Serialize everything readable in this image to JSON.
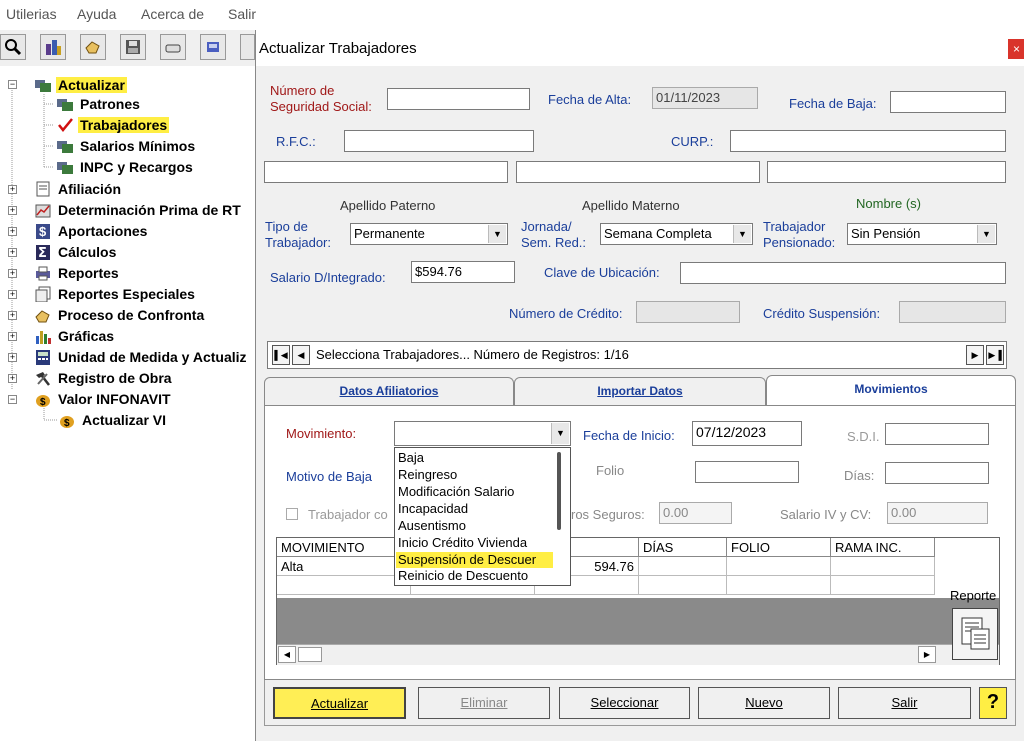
{
  "menubar": {
    "items": [
      "Utilerias",
      "Ayuda",
      "Acerca de",
      "Salir"
    ]
  },
  "tree": {
    "items": [
      {
        "label": "Actualizar",
        "expander": "−",
        "highlight": true
      },
      {
        "label": "Patrones"
      },
      {
        "label": "Trabajadores",
        "highlight": true
      },
      {
        "label": "Salarios Mínimos"
      },
      {
        "label": "INPC y Recargos"
      },
      {
        "label": "Afiliación",
        "expander": "+"
      },
      {
        "label": "Determinación Prima de RT",
        "expander": "+"
      },
      {
        "label": "Aportaciones",
        "expander": "+"
      },
      {
        "label": "Cálculos",
        "expander": "+"
      },
      {
        "label": "Reportes",
        "expander": "+"
      },
      {
        "label": "Reportes Especiales",
        "expander": "+"
      },
      {
        "label": "Proceso de Confronta",
        "expander": "+"
      },
      {
        "label": "Gráficas",
        "expander": "+"
      },
      {
        "label": "Unidad de Medida y Actualiz",
        "expander": "+"
      },
      {
        "label": "Registro de Obra",
        "expander": "+"
      },
      {
        "label": "Valor INFONAVIT",
        "expander": "−"
      },
      {
        "label": "Actualizar VI"
      }
    ]
  },
  "dialog": {
    "title": "Actualizar Trabajadores",
    "close": "×",
    "nss_label_1": "Número de",
    "nss_label_2": "Seguridad Social:",
    "fecha_alta_label": "Fecha de Alta:",
    "fecha_alta_value": "01/11/2023",
    "fecha_baja_label": "Fecha de Baja:",
    "rfc_label": "R.F.C.:",
    "curp_label": "CURP.:",
    "apellido_paterno": "Apellido Paterno",
    "apellido_materno": "Apellido Materno",
    "nombre": "Nombre (s)",
    "tipo_label_1": "Tipo de",
    "tipo_label_2": "Trabajador:",
    "tipo_value": "Permanente",
    "jornada_label_1": "Jornada/",
    "jornada_label_2": "Sem. Red.:",
    "jornada_value": "Semana Completa",
    "pensionado_label_1": "Trabajador",
    "pensionado_label_2": "Pensionado:",
    "pensionado_value": "Sin Pensión",
    "salario_label": "Salario D/Integrado:",
    "salario_value": "$594.76",
    "clave_label": "Clave de Ubicación:",
    "credito_label": "Número de Crédito:",
    "credito_susp_label": "Crédito Suspensión:",
    "navigator_text": "Selecciona Trabajadores...  Número de Registros:  1/16",
    "tabs": [
      "Datos Afiliatorios",
      "Importar Datos",
      "Movimientos"
    ],
    "movimiento_label": "Movimiento:",
    "fecha_inicio_label": "Fecha de Inicio:",
    "fecha_inicio_value": "07/12/2023",
    "sdi_label": "S.D.I.",
    "motivo_label": "Motivo de Baja",
    "folio_label": "Folio",
    "dias_label": "Días:",
    "trabajador_check": "Trabajador co",
    "otros_seguros_label": "ros Seguros:",
    "otros_seguros_value": "0.00",
    "salario_iv_label": "Salario IV y CV:",
    "salario_iv_value": "0.00",
    "dropdown_items": [
      "Baja",
      "Reingreso",
      "Modificación Salario",
      "Incapacidad",
      "Ausentismo",
      "Inicio Crédito Vivienda",
      "Suspensión de Descuer",
      "Reinicio de Descuento"
    ],
    "dropdown_selected": 6,
    "grid_headers": [
      "MOVIMIENTO",
      "DÍAS",
      "FOLIO",
      "RAMA INC."
    ],
    "grid_rows": [
      {
        "movimiento": "Alta",
        "salario": "594.76"
      }
    ],
    "reporte_label": "Reporte",
    "buttons": {
      "actualizar": "Actualizar",
      "eliminar": "Eliminar",
      "seleccionar": "Seleccionar",
      "nuevo": "Nuevo",
      "salir": "Salir",
      "help": "?"
    }
  },
  "colors": {
    "highlight": "#ffee44",
    "label_red": "#a01818",
    "label_blue": "#1a3e9a",
    "close": "#d9342b"
  }
}
